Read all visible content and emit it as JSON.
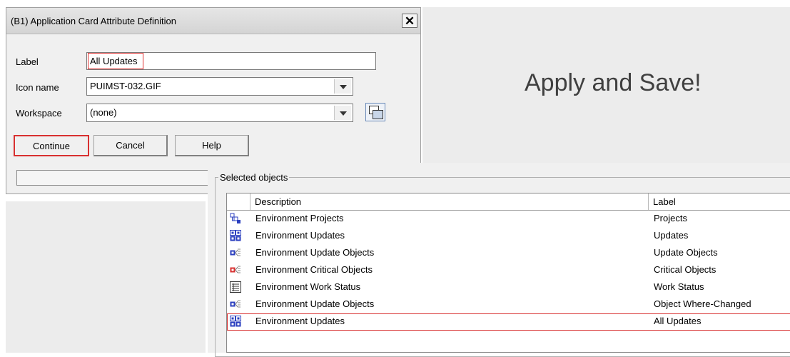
{
  "dialog": {
    "title": "(B1) Application Card Attribute Definition",
    "close_symbol": "✕",
    "label_caption": "Label",
    "label_value": "All Updates",
    "icon_caption": "Icon name",
    "icon_value": "PUIMST-032.GIF",
    "workspace_caption": "Workspace",
    "workspace_value": "(none)",
    "buttons": {
      "continue": "Continue",
      "cancel": "Cancel",
      "help": "Help"
    }
  },
  "callout": {
    "text": "Apply and Save!"
  },
  "selected_objects": {
    "title": "Selected objects",
    "columns": {
      "description": "Description",
      "label": "Label"
    },
    "rows": [
      {
        "icon": "projects-icon",
        "description": "Environment Projects",
        "label": "Projects"
      },
      {
        "icon": "updates-grid-icon",
        "description": "Environment Updates",
        "label": "Updates"
      },
      {
        "icon": "update-objects-icon",
        "description": "Environment Update Objects",
        "label": "Update Objects"
      },
      {
        "icon": "critical-objects-icon",
        "description": "Environment Critical Objects",
        "label": "Critical Objects"
      },
      {
        "icon": "work-status-icon",
        "description": "Environment Work Status",
        "label": "Work Status"
      },
      {
        "icon": "update-objects-icon",
        "description": "Environment Update Objects",
        "label": "Object Where-Changed"
      },
      {
        "icon": "updates-grid-icon",
        "description": "Environment Updates",
        "label": "All Updates"
      }
    ],
    "highlighted_row": 6
  },
  "colors": {
    "highlight_red": "#d83030",
    "icon_blue": "#2b3fbf"
  }
}
